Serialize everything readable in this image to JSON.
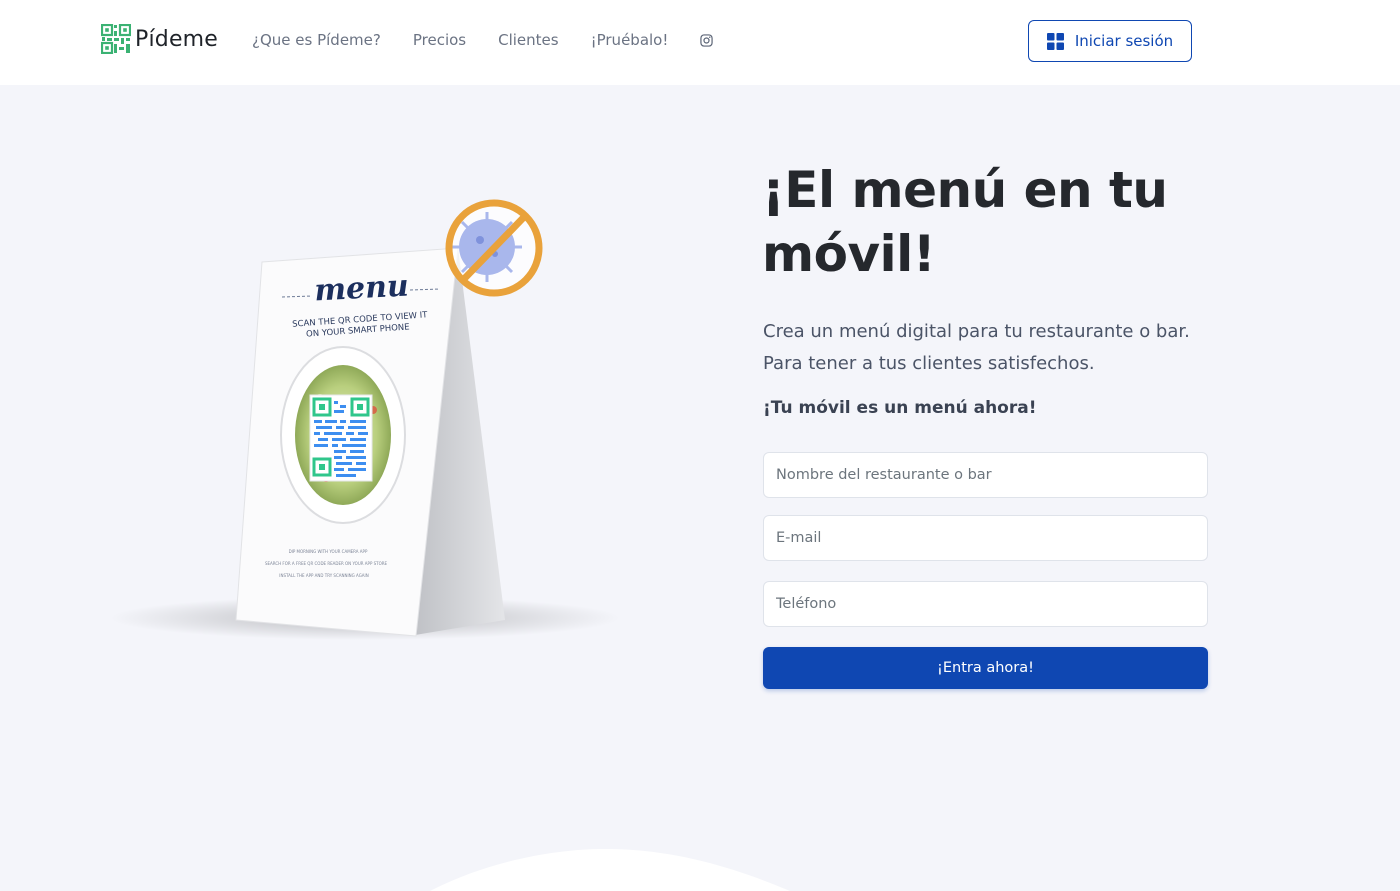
{
  "brand": {
    "name": "Pídeme",
    "logo_icon": "qr-code-logo-icon"
  },
  "nav": {
    "links": [
      "¿Que es Pídeme?",
      "Precios",
      "Clientes",
      "¡Pruébalo!"
    ],
    "instagram_icon": "instagram-icon"
  },
  "login": {
    "label": "Iniciar sesión",
    "icon": "grid-icon"
  },
  "hero": {
    "title": "¡El menú en tu móvil!",
    "lead_line1": "Crea un menú digital para tu restaurante o bar.",
    "lead_line2": "Para tener a tus clientes satisfechos.",
    "subtitle": "¡Tu móvil es un menú ahora!",
    "image": {
      "menu_title": "menu",
      "scan_line1": "SCAN THE QR CODE TO VIEW IT",
      "scan_line2": "ON YOUR SMART PHONE",
      "fine1": "DIP MORNING WITH YOUR CAMERA APP",
      "fine2": "SEARCH FOR A FREE QR CODE READER ON YOUR APP STORE",
      "fine3": "INSTALL THE APP AND TRY SCANNING AGAIN"
    }
  },
  "form": {
    "name_placeholder": "Nombre del restaurante o bar",
    "email_placeholder": "E-mail",
    "phone_placeholder": "Teléfono",
    "submit_label": "¡Entra ahora!"
  },
  "colors": {
    "primary": "#0f47b2",
    "background": "#f4f5fa",
    "logo_green": "#3bb273",
    "virus_ring": "#e9a23b"
  }
}
